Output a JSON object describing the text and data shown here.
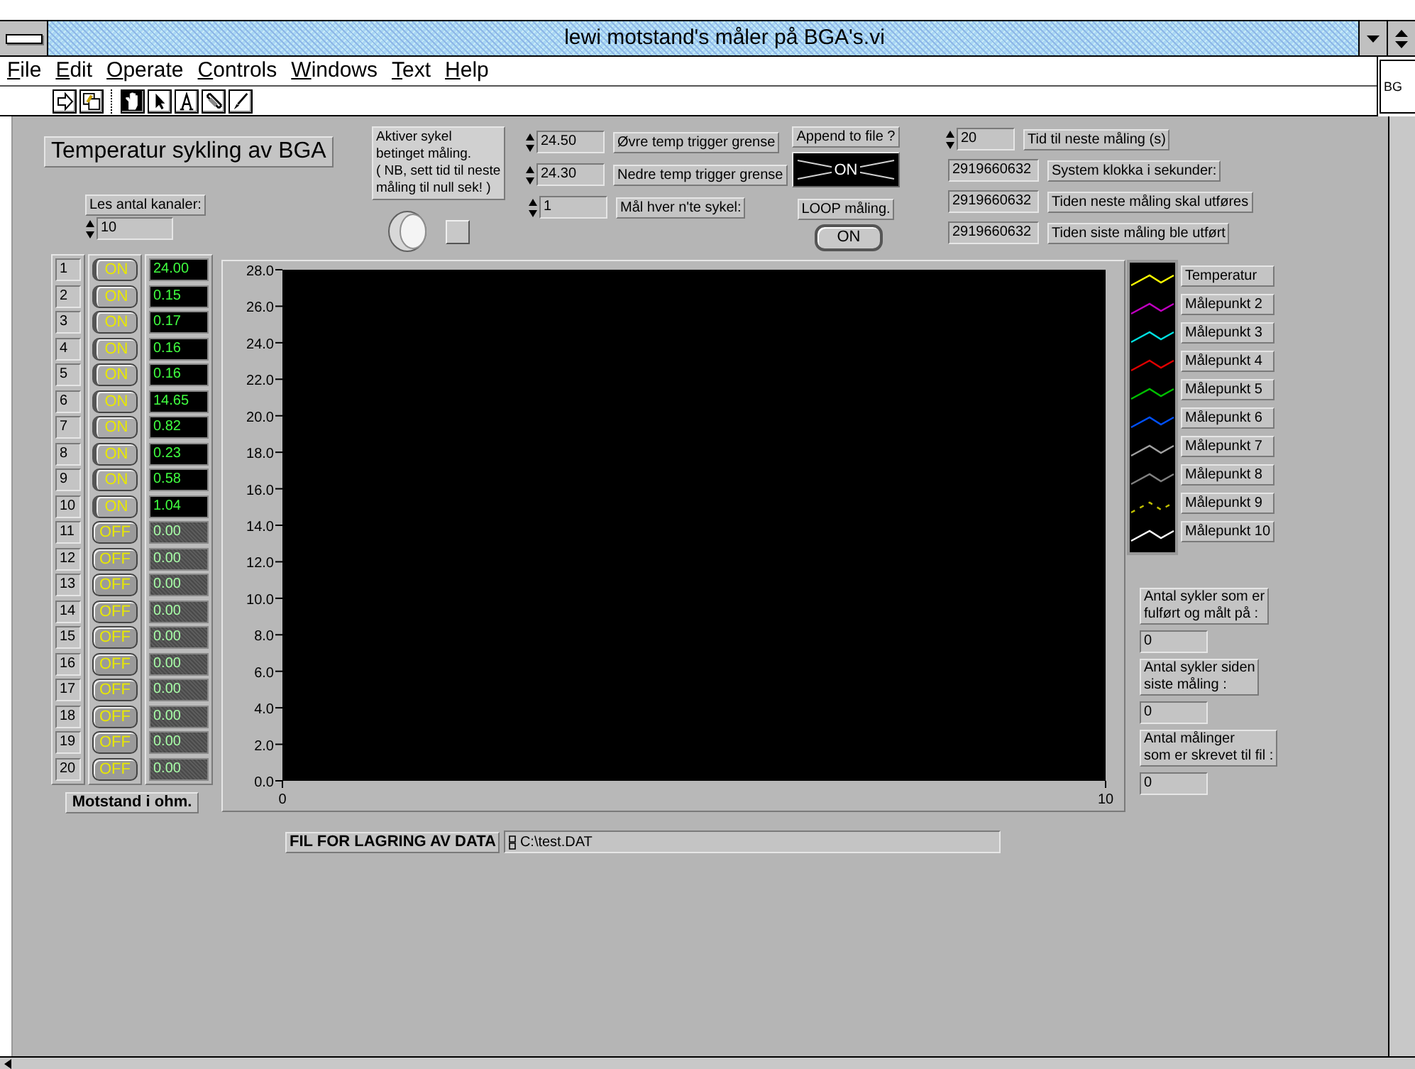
{
  "window": {
    "title": "lewi motstand's måler på BGA's.vi"
  },
  "menu": [
    {
      "label": "File"
    },
    {
      "label": "Edit"
    },
    {
      "label": "Operate"
    },
    {
      "label": "Controls"
    },
    {
      "label": "Windows"
    },
    {
      "label": "Text"
    },
    {
      "label": "Help"
    }
  ],
  "tools": [
    {
      "selected": true
    },
    {
      "selected": false
    },
    {
      "selected": false
    },
    {
      "selected": false
    },
    {
      "selected": false
    }
  ],
  "side_window": {
    "title": "BG"
  },
  "panel": {
    "heading": "Temperatur sykling av BGA",
    "channel_count": {
      "label": "Les antal kanaler:",
      "value": "10"
    },
    "cycle_note": "Aktiver sykel\nbetinget måling.\n( NB, sett tid til neste\nmåling til null sek! )",
    "cycle_toggle": {
      "on": false
    },
    "triggers": [
      {
        "value": "24.50",
        "label": "Øvre temp trigger grense"
      },
      {
        "value": "24.30",
        "label": "Nedre temp trigger grense"
      },
      {
        "value": "1",
        "label": "Mål  hver n'te sykel:"
      }
    ],
    "append_to_file": {
      "label": "Append to file ?",
      "on": true,
      "text": "ON"
    },
    "loop": {
      "label": "LOOP måling.",
      "on": true,
      "text": "ON"
    },
    "timing": [
      {
        "kind": "control",
        "value": "20",
        "label": "Tid til neste måling (s)"
      },
      {
        "kind": "indicator",
        "value": "2919660632",
        "label": "System klokka i sekunder:"
      },
      {
        "kind": "indicator",
        "value": "2919660632",
        "label": "Tiden neste måling skal utføres"
      },
      {
        "kind": "indicator",
        "value": "2919660632",
        "label": "Tiden siste måling ble utført"
      }
    ],
    "channels": [
      {
        "number": "1",
        "on": true,
        "switch": "ON",
        "value": "24.00"
      },
      {
        "number": "2",
        "on": true,
        "switch": "ON",
        "value": "0.15"
      },
      {
        "number": "3",
        "on": true,
        "switch": "ON",
        "value": "0.17"
      },
      {
        "number": "4",
        "on": true,
        "switch": "ON",
        "value": "0.16"
      },
      {
        "number": "5",
        "on": true,
        "switch": "ON",
        "value": "0.16"
      },
      {
        "number": "6",
        "on": true,
        "switch": "ON",
        "value": "14.65"
      },
      {
        "number": "7",
        "on": true,
        "switch": "ON",
        "value": "0.82"
      },
      {
        "number": "8",
        "on": true,
        "switch": "ON",
        "value": "0.23"
      },
      {
        "number": "9",
        "on": true,
        "switch": "ON",
        "value": "0.58"
      },
      {
        "number": "10",
        "on": true,
        "switch": "ON",
        "value": "1.04"
      },
      {
        "number": "11",
        "on": false,
        "switch": "OFF",
        "value": "0.00"
      },
      {
        "number": "12",
        "on": false,
        "switch": "OFF",
        "value": "0.00"
      },
      {
        "number": "13",
        "on": false,
        "switch": "OFF",
        "value": "0.00"
      },
      {
        "number": "14",
        "on": false,
        "switch": "OFF",
        "value": "0.00"
      },
      {
        "number": "15",
        "on": false,
        "switch": "OFF",
        "value": "0.00"
      },
      {
        "number": "16",
        "on": false,
        "switch": "OFF",
        "value": "0.00"
      },
      {
        "number": "17",
        "on": false,
        "switch": "OFF",
        "value": "0.00"
      },
      {
        "number": "18",
        "on": false,
        "switch": "OFF",
        "value": "0.00"
      },
      {
        "number": "19",
        "on": false,
        "switch": "OFF",
        "value": "0.00"
      },
      {
        "number": "20",
        "on": false,
        "switch": "OFF",
        "value": "0.00"
      }
    ],
    "channels_caption": "Motstand i ohm.",
    "graph": {
      "chart_data": {
        "type": "line",
        "xlim": [
          0,
          10
        ],
        "ylim": [
          0,
          28
        ],
        "xticks": [
          0,
          10
        ],
        "yticks": [
          {
            "value": 0,
            "label": "0.0"
          },
          {
            "value": 2,
            "label": "2.0"
          },
          {
            "value": 4,
            "label": "4.0"
          },
          {
            "value": 6,
            "label": "6.0"
          },
          {
            "value": 8,
            "label": "8.0"
          },
          {
            "value": 10,
            "label": "10.0"
          },
          {
            "value": 12,
            "label": "12.0"
          },
          {
            "value": 14,
            "label": "14.0"
          },
          {
            "value": 16,
            "label": "16.0"
          },
          {
            "value": 18,
            "label": "18.0"
          },
          {
            "value": 20,
            "label": "20.0"
          },
          {
            "value": 22,
            "label": "22.0"
          },
          {
            "value": 24,
            "label": "24.0"
          },
          {
            "value": 26,
            "label": "26.0"
          },
          {
            "value": 28,
            "label": "28.0"
          }
        ]
      }
    },
    "legend": [
      {
        "name": "Temperatur",
        "color": "#ffff00",
        "kind": "solid"
      },
      {
        "name": "Målepunkt 2",
        "color": "#c000c0",
        "kind": "solid"
      },
      {
        "name": "Målepunkt 3",
        "color": "#00e0e0",
        "kind": "solid"
      },
      {
        "name": "Målepunkt 4",
        "color": "#e00000",
        "kind": "solid"
      },
      {
        "name": "Målepunkt 5",
        "color": "#00c000",
        "kind": "solid"
      },
      {
        "name": "Målepunkt 6",
        "color": "#0050ff",
        "kind": "solid"
      },
      {
        "name": "Målepunkt 7",
        "color": "#a0a0a0",
        "kind": "solid"
      },
      {
        "name": "Målepunkt 8",
        "color": "#808080",
        "kind": "solid"
      },
      {
        "name": "Målepunkt 9",
        "color": "#c0c000",
        "kind": "dashed"
      },
      {
        "name": "Målepunkt 10",
        "color": "#ffffff",
        "kind": "solid"
      }
    ],
    "counters": [
      {
        "label": "Antal sykler som er\nfulført og målt på :",
        "value": "0"
      },
      {
        "label": "Antal sykler siden\nsiste måling :",
        "value": "0"
      },
      {
        "label": "Antal  målinger\nsom er skrevet til fil :",
        "value": "0"
      }
    ],
    "file": {
      "label": "FIL FOR LAGRING AV DATA",
      "path": "C:\\test.DAT"
    }
  }
}
